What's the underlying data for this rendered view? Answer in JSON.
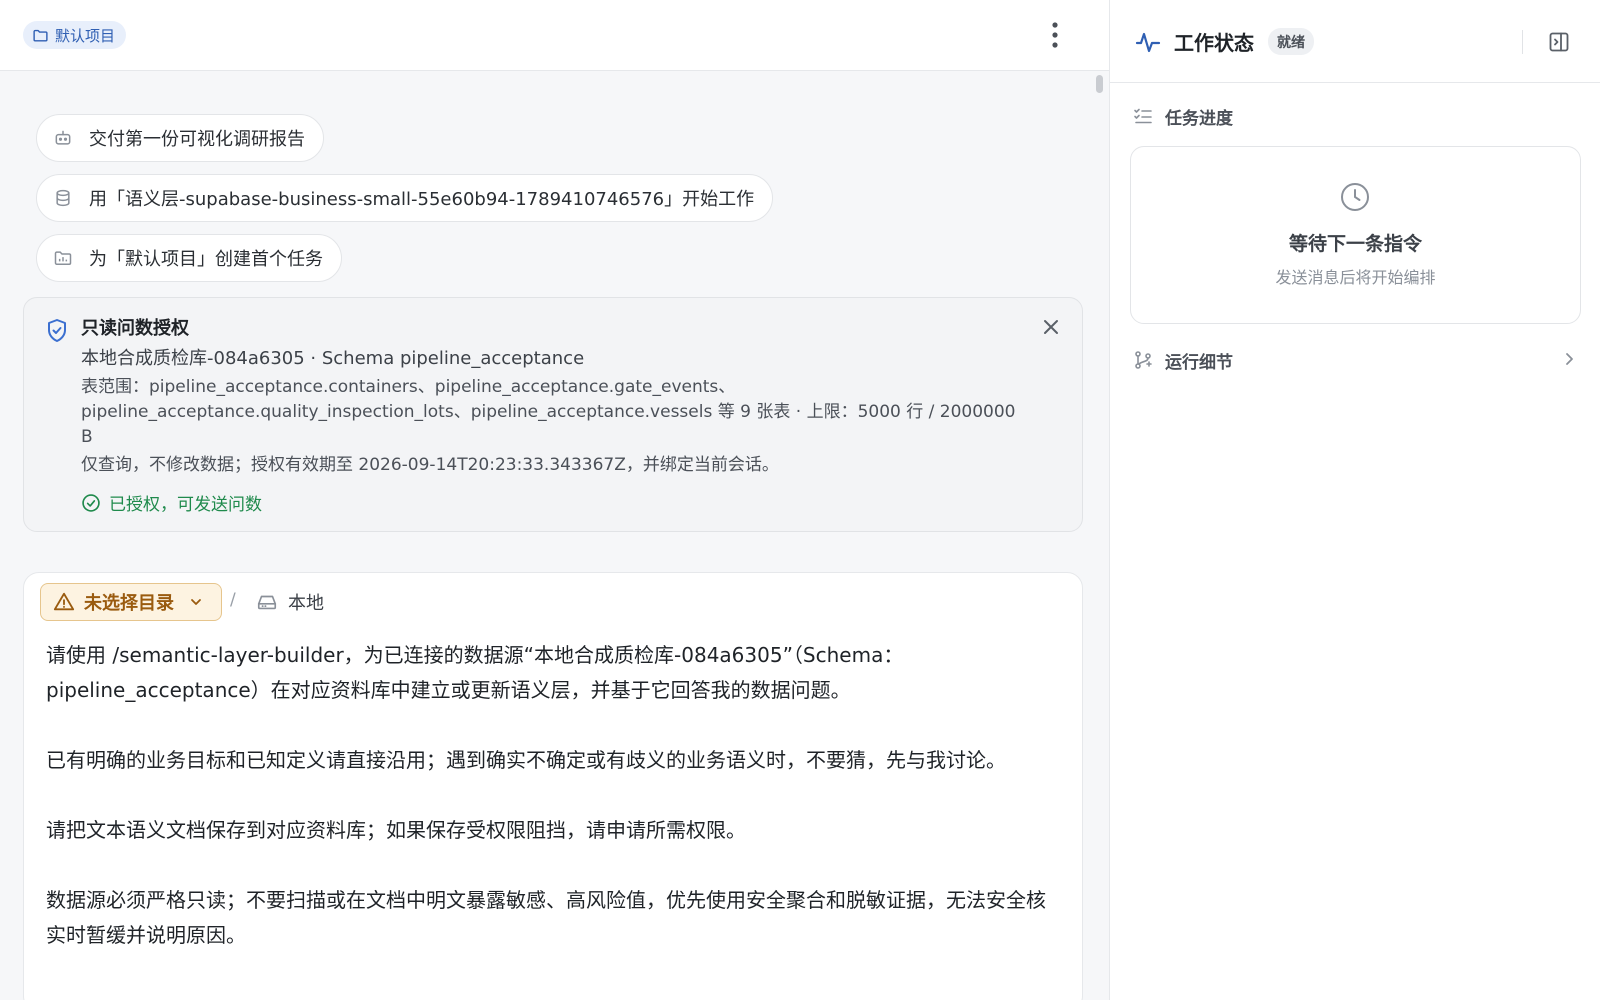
{
  "main": {
    "project_chip": "默认项目",
    "suggestions": [
      "交付第一份可视化调研报告",
      "用「语义层-supabase-business-small-55e60b94-1789410746576」开始工作",
      "为「默认项目」创建首个任务"
    ],
    "auth_card": {
      "title": "只读问数授权",
      "source_line": "本地合成质检库-084a6305 · Schema pipeline_acceptance",
      "scope_line": "表范围：pipeline_acceptance.containers、pipeline_acceptance.gate_events、pipeline_acceptance.quality_inspection_lots、pipeline_acceptance.vessels 等 9 张表 · 上限：5000 行 / 2000000 B",
      "policy_line": "仅查询，不修改数据；授权有效期至 2026-09-14T20:23:33.343367Z，并绑定当前会话。",
      "status": "已授权，可发送问数"
    },
    "composer": {
      "directory_label": "未选择目录",
      "separator": "/",
      "location_label": "本地",
      "paragraphs": [
        "请使用 /semantic-layer-builder，为已连接的数据源“本地合成质检库-084a6305”（Schema：pipeline_acceptance）在对应资料库中建立或更新语义层，并基于它回答我的数据问题。",
        "已有明确的业务目标和已知定义请直接沿用；遇到确实不确定或有歧义的业务语义时，不要猜，先与我讨论。",
        "请把文本语义文档保存到对应资料库；如果保存受权限阻挡，请申请所需权限。",
        "数据源必须严格只读；不要扫描或在文档中明文暴露敏感、高风险值，优先使用安全聚合和脱敏证据，无法安全核实时暂缓并说明原因。"
      ]
    }
  },
  "side": {
    "title": "工作状态",
    "badge": "就绪",
    "task_progress_label": "任务进度",
    "waiting_title": "等待下一条指令",
    "waiting_subtitle": "发送消息后将开始编排",
    "run_details_label": "运行细节"
  },
  "colors": {
    "accent": "#2f5fb3",
    "success": "#1f8a4c",
    "warning": "#9a5b0f"
  },
  "icons": {
    "project": "folder-icon",
    "more": "more-vertical-icon",
    "suggest_1": "robot-icon",
    "suggest_2": "database-icon",
    "suggest_3": "folder-task-icon",
    "auth": "shield-check-icon",
    "close": "close-icon",
    "status": "check-circle-icon",
    "warning": "warning-icon",
    "chevron": "chevron-down-icon",
    "location": "drive-icon",
    "activity": "activity-icon",
    "collapse": "panel-collapse-icon",
    "task_list": "list-check-icon",
    "clock": "clock-icon",
    "run_details": "git-branch-icon",
    "chevron_right": "chevron-right-icon"
  }
}
